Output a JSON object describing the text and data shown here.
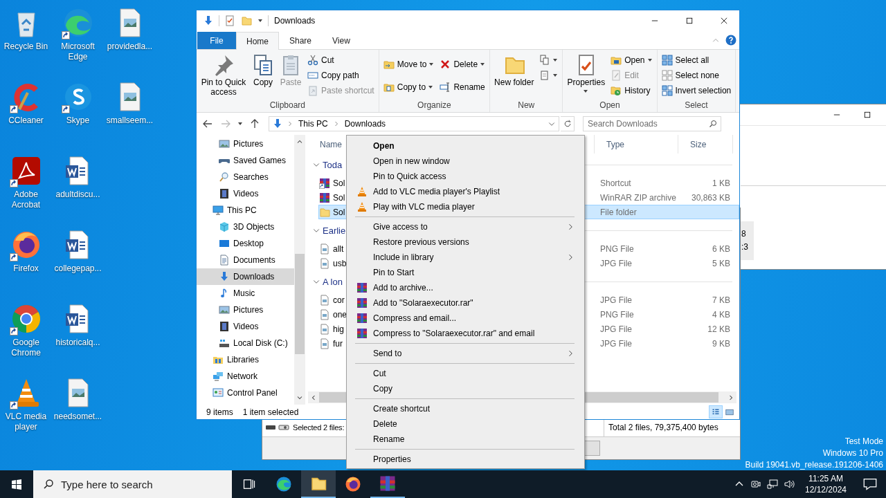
{
  "desktop": {
    "icons": [
      {
        "label": "Recycle Bin",
        "shortcut": false
      },
      {
        "label": "CCleaner",
        "shortcut": true
      },
      {
        "label": "Adobe Acrobat",
        "shortcut": true
      },
      {
        "label": "Firefox",
        "shortcut": true
      },
      {
        "label": "Google Chrome",
        "shortcut": true
      },
      {
        "label": "VLC media player",
        "shortcut": true
      },
      {
        "label": "Microsoft Edge",
        "shortcut": true
      },
      {
        "label": "Skype",
        "shortcut": true
      },
      {
        "label": "adultdiscu...",
        "shortcut": false
      },
      {
        "label": "collegepap...",
        "shortcut": false
      },
      {
        "label": "historicalq...",
        "shortcut": false
      },
      {
        "label": "needsomet...",
        "shortcut": false
      },
      {
        "label": "providedla...",
        "shortcut": false
      },
      {
        "label": "smallseem...",
        "shortcut": false
      }
    ],
    "system_notice": [
      "Test Mode",
      "Windows 10 Pro",
      "Build 19041.vb_release.191206-1406"
    ]
  },
  "side_window": {
    "fragments": [
      "8",
      ":3"
    ]
  },
  "archive_window": {
    "selection": "Selected 2 files:",
    "total": "Total 2 files, 79,375,400 bytes"
  },
  "explorer": {
    "title": "Downloads",
    "tabs": [
      {
        "label": "File",
        "kind": "file",
        "selected": false
      },
      {
        "label": "Home",
        "kind": "tab",
        "selected": true
      },
      {
        "label": "Share",
        "kind": "tab",
        "selected": false
      },
      {
        "label": "View",
        "kind": "tab",
        "selected": false
      }
    ],
    "ribbon": [
      {
        "label": "Clipboard",
        "items": [
          {
            "kind": "large",
            "label": "Pin to Quick access",
            "disabled": false
          },
          {
            "kind": "large",
            "label": "Copy",
            "disabled": false
          },
          {
            "kind": "large",
            "label": "Paste",
            "disabled": true
          },
          {
            "kind": "small",
            "label": "Cut",
            "disabled": false
          },
          {
            "kind": "small",
            "label": "Copy path",
            "disabled": false
          },
          {
            "kind": "small",
            "label": "Paste shortcut",
            "disabled": true
          }
        ]
      },
      {
        "label": "Organize",
        "items": [
          {
            "kind": "medium",
            "label": "Move to",
            "disabled": false,
            "dropdown": true
          },
          {
            "kind": "medium",
            "label": "Copy to",
            "disabled": false,
            "dropdown": true
          },
          {
            "kind": "medium",
            "label": "Delete",
            "disabled": false,
            "dropdown": true
          },
          {
            "kind": "medium",
            "label": "Rename",
            "disabled": false
          }
        ]
      },
      {
        "label": "New",
        "items": [
          {
            "kind": "large",
            "label": "New folder",
            "disabled": false
          },
          {
            "kind": "small",
            "disabled": false,
            "dropdown": true
          },
          {
            "kind": "small",
            "disabled": false,
            "dropdown": true
          }
        ]
      },
      {
        "label": "Open",
        "items": [
          {
            "kind": "large",
            "label": "Properties",
            "disabled": false,
            "dropdown": true
          },
          {
            "kind": "small",
            "label": "Open",
            "disabled": false,
            "dropdown": true
          },
          {
            "kind": "small",
            "label": "Edit",
            "disabled": true
          },
          {
            "kind": "small",
            "label": "History",
            "disabled": false
          }
        ]
      },
      {
        "label": "Select",
        "items": [
          {
            "kind": "small",
            "label": "Select all",
            "disabled": false
          },
          {
            "kind": "small",
            "label": "Select none",
            "disabled": false
          },
          {
            "kind": "small",
            "label": "Invert selection",
            "disabled": false
          }
        ]
      }
    ],
    "address": [
      "This PC",
      "Downloads"
    ],
    "search": {
      "placeholder": "Search Downloads"
    },
    "nav": [
      {
        "children": [
          {
            "label": "Pictures",
            "selected": false
          },
          {
            "label": "Saved Games",
            "selected": false
          },
          {
            "label": "Searches",
            "selected": false
          },
          {
            "label": "Videos",
            "selected": false
          }
        ]
      },
      {
        "label": "This PC",
        "selected": false,
        "children": [
          {
            "label": "3D Objects",
            "selected": false
          },
          {
            "label": "Desktop",
            "selected": false
          },
          {
            "label": "Documents",
            "selected": false
          },
          {
            "label": "Downloads",
            "selected": true
          },
          {
            "label": "Music",
            "selected": false
          },
          {
            "label": "Pictures",
            "selected": false
          },
          {
            "label": "Videos",
            "selected": false
          },
          {
            "label": "Local Disk (C:)",
            "selected": false
          }
        ]
      },
      {
        "label": "Libraries",
        "selected": false
      },
      {
        "label": "Network",
        "selected": false
      },
      {
        "label": "Control Panel",
        "selected": false
      }
    ],
    "columns": [
      "Name",
      "Type",
      "Size"
    ],
    "groups": [
      {
        "label": "Toda",
        "expanded": true,
        "rows": [
          {
            "name": "Sol",
            "kind": "shortcut",
            "type": "Shortcut",
            "size": "1 KB",
            "selected": false
          },
          {
            "name": "Sol",
            "kind": "archive",
            "type": "WinRAR ZIP archive",
            "size": "30,863 KB",
            "selected": false
          },
          {
            "name": "Sol",
            "kind": "folder",
            "type": "File folder",
            "selected": true
          }
        ]
      },
      {
        "label": "Earlie",
        "expanded": true,
        "rows": [
          {
            "name": "allt",
            "kind": "image",
            "type": "PNG File",
            "size": "6 KB",
            "selected": false
          },
          {
            "name": "usb",
            "kind": "image",
            "type": "JPG File",
            "size": "5 KB",
            "selected": false
          }
        ]
      },
      {
        "label": "A lon",
        "expanded": true,
        "rows": [
          {
            "name": "cor",
            "kind": "image",
            "type": "JPG File",
            "size": "7 KB",
            "selected": false
          },
          {
            "name": "one",
            "kind": "image",
            "type": "PNG File",
            "size": "4 KB",
            "selected": false
          },
          {
            "name": "hig",
            "kind": "image",
            "type": "JPG File",
            "size": "12 KB",
            "selected": false
          },
          {
            "name": "fur",
            "kind": "image",
            "type": "JPG File",
            "size": "9 KB",
            "selected": false
          }
        ]
      }
    ],
    "status": {
      "count": "9 items",
      "selection": "1 item selected"
    },
    "views": [
      {
        "selected": true
      },
      {
        "selected": false
      }
    ]
  },
  "context_menu": [
    {
      "kind": "plain",
      "label": "Open",
      "bold": true,
      "submenu": false
    },
    {
      "kind": "plain",
      "label": "Open in new window",
      "bold": false,
      "submenu": false
    },
    {
      "kind": "plain",
      "label": "Pin to Quick access",
      "bold": false,
      "submenu": false
    },
    {
      "kind": "vlc",
      "label": "Add to VLC media player's Playlist",
      "bold": false,
      "submenu": false
    },
    {
      "kind": "vlc",
      "label": "Play with VLC media player",
      "bold": false,
      "submenu": false
    },
    {
      "kind": "separator"
    },
    {
      "kind": "plain",
      "label": "Give access to",
      "bold": false,
      "submenu": true
    },
    {
      "kind": "plain",
      "label": "Restore previous versions",
      "bold": false,
      "submenu": false
    },
    {
      "kind": "plain",
      "label": "Include in library",
      "bold": false,
      "submenu": true
    },
    {
      "kind": "plain",
      "label": "Pin to Start",
      "bold": false,
      "submenu": false
    },
    {
      "kind": "rar",
      "label": "Add to archive...",
      "bold": false,
      "submenu": false
    },
    {
      "kind": "rar",
      "label": "Add to \"Solaraexecutor.rar\"",
      "bold": false,
      "submenu": false
    },
    {
      "kind": "rar",
      "label": "Compress and email...",
      "bold": false,
      "submenu": false
    },
    {
      "kind": "rar",
      "label": "Compress to \"Solaraexecutor.rar\" and email",
      "bold": false,
      "submenu": false
    },
    {
      "kind": "separator"
    },
    {
      "kind": "plain",
      "label": "Send to",
      "bold": false,
      "submenu": true
    },
    {
      "kind": "separator"
    },
    {
      "kind": "plain",
      "label": "Cut",
      "bold": false,
      "submenu": false
    },
    {
      "kind": "plain",
      "label": "Copy",
      "bold": false,
      "submenu": false
    },
    {
      "kind": "separator"
    },
    {
      "kind": "plain",
      "label": "Create shortcut",
      "bold": false,
      "submenu": false
    },
    {
      "kind": "plain",
      "label": "Delete",
      "bold": false,
      "submenu": false
    },
    {
      "kind": "plain",
      "label": "Rename",
      "bold": false,
      "submenu": false
    },
    {
      "kind": "separator"
    },
    {
      "kind": "plain",
      "label": "Properties",
      "bold": false,
      "submenu": false
    }
  ],
  "taskbar": {
    "search": {
      "placeholder": "Type here to search"
    },
    "apps": [
      {
        "running": false,
        "selected": false
      },
      {
        "running": true,
        "selected": true
      },
      {
        "running": false,
        "selected": false
      },
      {
        "running": true,
        "selected": false
      }
    ],
    "time": "11:25 AM",
    "date": "12/12/2024"
  }
}
